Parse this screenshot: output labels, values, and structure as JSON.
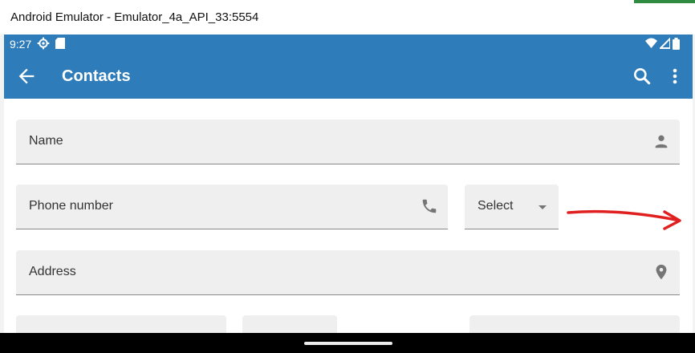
{
  "window": {
    "title": "Android Emulator - Emulator_4a_API_33:5554"
  },
  "status_bar": {
    "time": "9:27",
    "icons": [
      "settings-gear-icon",
      "sd-card-icon",
      "wifi-icon",
      "signal-icon",
      "battery-icon"
    ]
  },
  "app_bar": {
    "title": "Contacts",
    "icons": [
      "back-arrow-icon",
      "search-icon",
      "more-vert-icon"
    ]
  },
  "form": {
    "name_label": "Name",
    "phone_label": "Phone number",
    "select_value": "Select",
    "address_label": "Address"
  },
  "colors": {
    "app_bar": "#2f7cba",
    "field_bg": "#efefef",
    "annotation_arrow": "#e02020"
  }
}
